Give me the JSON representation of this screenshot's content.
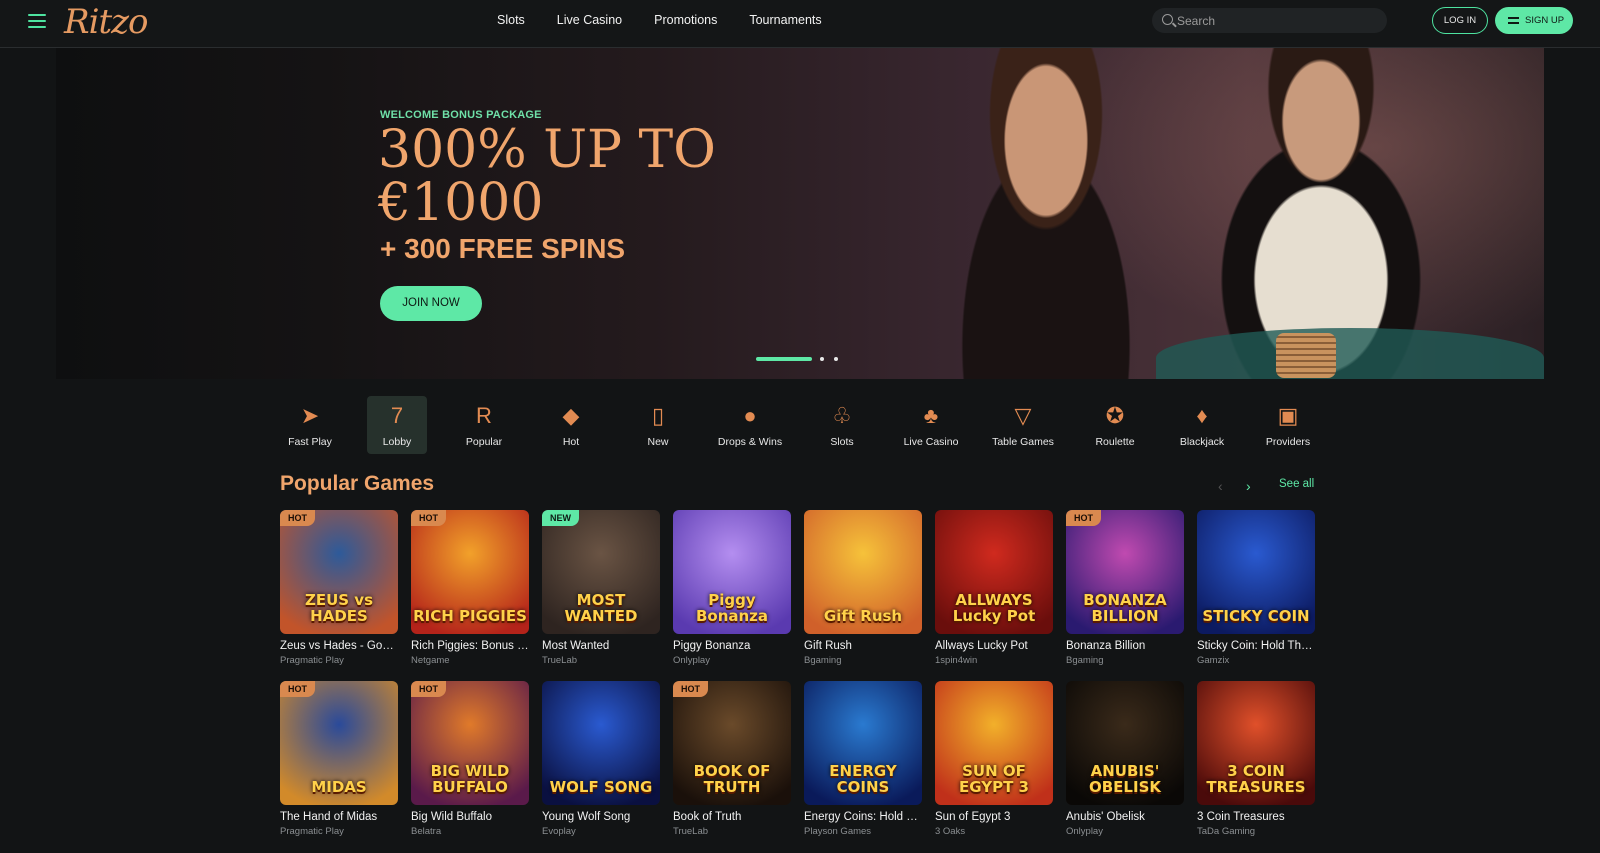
{
  "header": {
    "logo": "Ritzo",
    "nav": [
      "Slots",
      "Live Casino",
      "Promotions",
      "Tournaments"
    ],
    "search_placeholder": "Search",
    "login_label": "LOG IN",
    "signup_label": "SIGN UP"
  },
  "hero": {
    "subtitle": "WELCOME BONUS PACKAGE",
    "title": "300% UP TO €1000",
    "spins": "+ 300 FREE SPINS",
    "cta": "JOIN NOW",
    "slides": 3,
    "active_slide": 1
  },
  "categories": [
    {
      "label": "Fast Play",
      "icon": "fast-play-icon",
      "glyph": "➤",
      "active": false
    },
    {
      "label": "Lobby",
      "icon": "lobby-icon",
      "glyph": "7",
      "active": true
    },
    {
      "label": "Popular",
      "icon": "popular-icon",
      "glyph": "R",
      "active": false
    },
    {
      "label": "Hot",
      "icon": "diamond-icon",
      "glyph": "◆",
      "active": false
    },
    {
      "label": "New",
      "icon": "new-tag-icon",
      "glyph": "▯",
      "active": false
    },
    {
      "label": "Drops & Wins",
      "icon": "drops-wins-icon",
      "glyph": "●",
      "active": false
    },
    {
      "label": "Slots",
      "icon": "cherries-icon",
      "glyph": "♧",
      "active": false
    },
    {
      "label": "Live Casino",
      "icon": "clubs-icon",
      "glyph": "♣",
      "active": false
    },
    {
      "label": "Table Games",
      "icon": "cocktail-icon",
      "glyph": "▽",
      "active": false
    },
    {
      "label": "Roulette",
      "icon": "roulette-icon",
      "glyph": "✪",
      "active": false
    },
    {
      "label": "Blackjack",
      "icon": "cards-icon",
      "glyph": "♦",
      "active": false
    },
    {
      "label": "Providers",
      "icon": "providers-icon",
      "glyph": "▣",
      "active": false
    }
  ],
  "popular": {
    "title": "Popular Games",
    "see_all": "See all",
    "games": [
      {
        "name": "Zeus vs Hades - Gods of War",
        "provider": "Pragmatic Play",
        "badge": "HOT",
        "art_text": "ZEUS vs HADES",
        "bg1": "#2d5a9a",
        "bg2": "#c2542a"
      },
      {
        "name": "Rich Piggies: Bonus Combo",
        "provider": "Netgame",
        "badge": "HOT",
        "art_text": "RICH PIGGIES",
        "bg1": "#f2a12a",
        "bg2": "#b4231a"
      },
      {
        "name": "Most Wanted",
        "provider": "TrueLab",
        "badge": "NEW",
        "art_text": "MOST WANTED",
        "bg1": "#6a5444",
        "bg2": "#2e2420"
      },
      {
        "name": "Piggy Bonanza",
        "provider": "Onlyplay",
        "badge": "",
        "art_text": "Piggy Bonanza",
        "bg1": "#b48ef0",
        "bg2": "#5a3ab0"
      },
      {
        "name": "Gift Rush",
        "provider": "Bgaming",
        "badge": "",
        "art_text": "Gift Rush",
        "bg1": "#f6c23a",
        "bg2": "#d0602a"
      },
      {
        "name": "Allways Lucky Pot",
        "provider": "1spin4win",
        "badge": "",
        "art_text": "ALLWAYS Lucky Pot",
        "bg1": "#d02a1e",
        "bg2": "#6a0e0c"
      },
      {
        "name": "Bonanza Billion",
        "provider": "Bgaming",
        "badge": "HOT",
        "art_text": "BONANZA BILLION",
        "bg1": "#c04ab0",
        "bg2": "#2a1a70"
      },
      {
        "name": "Sticky Coin: Hold The Spin",
        "provider": "Gamzix",
        "badge": "",
        "art_text": "STICKY COIN",
        "bg1": "#2a5ad0",
        "bg2": "#0c1a60"
      },
      {
        "name": "The Hand of Midas",
        "provider": "Pragmatic Play",
        "badge": "HOT",
        "art_text": "MIDAS",
        "bg1": "#2a4a9a",
        "bg2": "#d28a2a"
      },
      {
        "name": "Big Wild Buffalo",
        "provider": "Belatra",
        "badge": "HOT",
        "art_text": "BIG WILD BUFFALO",
        "bg1": "#e07a2a",
        "bg2": "#5a1a4a"
      },
      {
        "name": "Young Wolf Song",
        "provider": "Evoplay",
        "badge": "",
        "art_text": "WOLF SONG",
        "bg1": "#2a5ad0",
        "bg2": "#0a1040"
      },
      {
        "name": "Book of Truth",
        "provider": "TrueLab",
        "badge": "HOT",
        "art_text": "BOOK OF TRUTH",
        "bg1": "#6a4a2a",
        "bg2": "#1a100a"
      },
      {
        "name": "Energy Coins: Hold and Win",
        "provider": "Playson Games",
        "badge": "",
        "art_text": "ENERGY COINS",
        "bg1": "#2a7ad0",
        "bg2": "#0a1a5a"
      },
      {
        "name": "Sun of Egypt 3",
        "provider": "3 Oaks",
        "badge": "",
        "art_text": "SUN OF EGYPT 3",
        "bg1": "#f2b02a",
        "bg2": "#c0301a"
      },
      {
        "name": "Anubis' Obelisk",
        "provider": "Onlyplay",
        "badge": "",
        "art_text": "ANUBIS' OBELISK",
        "bg1": "#3a2a1a",
        "bg2": "#0a0806"
      },
      {
        "name": "3 Coin Treasures",
        "provider": "TaDa Gaming",
        "badge": "",
        "art_text": "3 COIN TREASURES",
        "bg1": "#e0502a",
        "bg2": "#4a0a0a"
      }
    ]
  }
}
